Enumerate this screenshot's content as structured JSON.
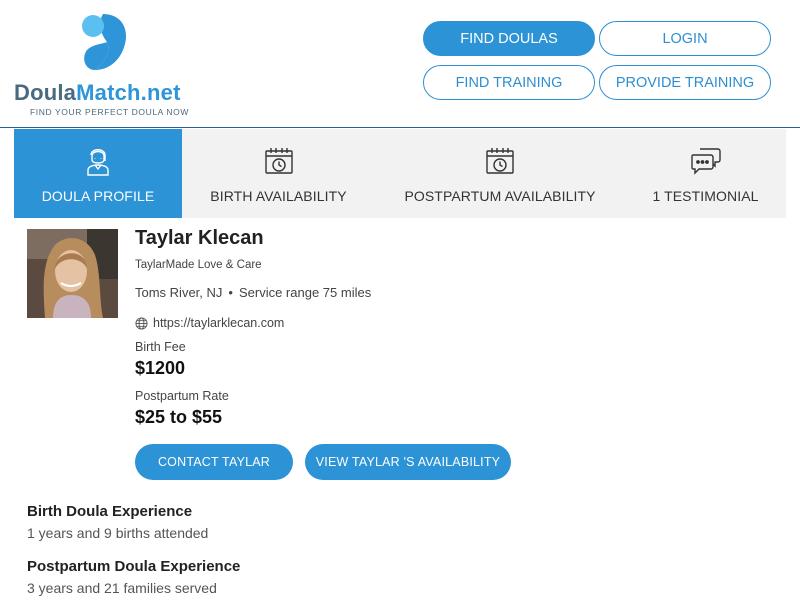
{
  "logo": {
    "name_part1": "Doula",
    "name_part2": "Match.net",
    "tagline": "FIND YOUR PERFECT DOULA NOW",
    "colors": {
      "dark": "#4a6a80",
      "accent": "#2e95d8",
      "light": "#5bc0f0"
    }
  },
  "nav": {
    "find_doulas": "FIND DOULAS",
    "login": "LOGIN",
    "find_training": "FIND TRAINING",
    "provide_training": "PROVIDE TRAINING"
  },
  "tabs": [
    {
      "label": "DOULA PROFILE",
      "icon": "doula-person-icon",
      "active": true
    },
    {
      "label": "BIRTH AVAILABILITY",
      "icon": "calendar-clock-icon",
      "active": false
    },
    {
      "label": "POSTPARTUM AVAILABILITY",
      "icon": "calendar-clock-icon",
      "active": false
    },
    {
      "label": "1 TESTIMONIAL",
      "icon": "chat-bubbles-icon",
      "active": false
    }
  ],
  "profile": {
    "name": "Taylar Klecan",
    "business": "TaylarMade Love & Care",
    "city": "Toms River, NJ",
    "service_range": "Service range 75 miles",
    "website": "https://taylarklecan.com",
    "birth_fee_label": "Birth Fee",
    "birth_fee": "$1200",
    "postpartum_label": "Postpartum Rate",
    "postpartum_rate": "$25 to $55",
    "contact_button": "CONTACT TAYLAR",
    "availability_button": "VIEW TAYLAR 'S AVAILABILITY"
  },
  "experience": {
    "birth_title": "Birth Doula Experience",
    "birth_text": "1 years and 9 births attended",
    "postpartum_title": "Postpartum Doula Experience",
    "postpartum_text": "3 years and 21 families served"
  },
  "colors": {
    "primary": "#2b93d6",
    "tab_bg": "#f2f2f2",
    "divider": "#2b5f8f"
  }
}
